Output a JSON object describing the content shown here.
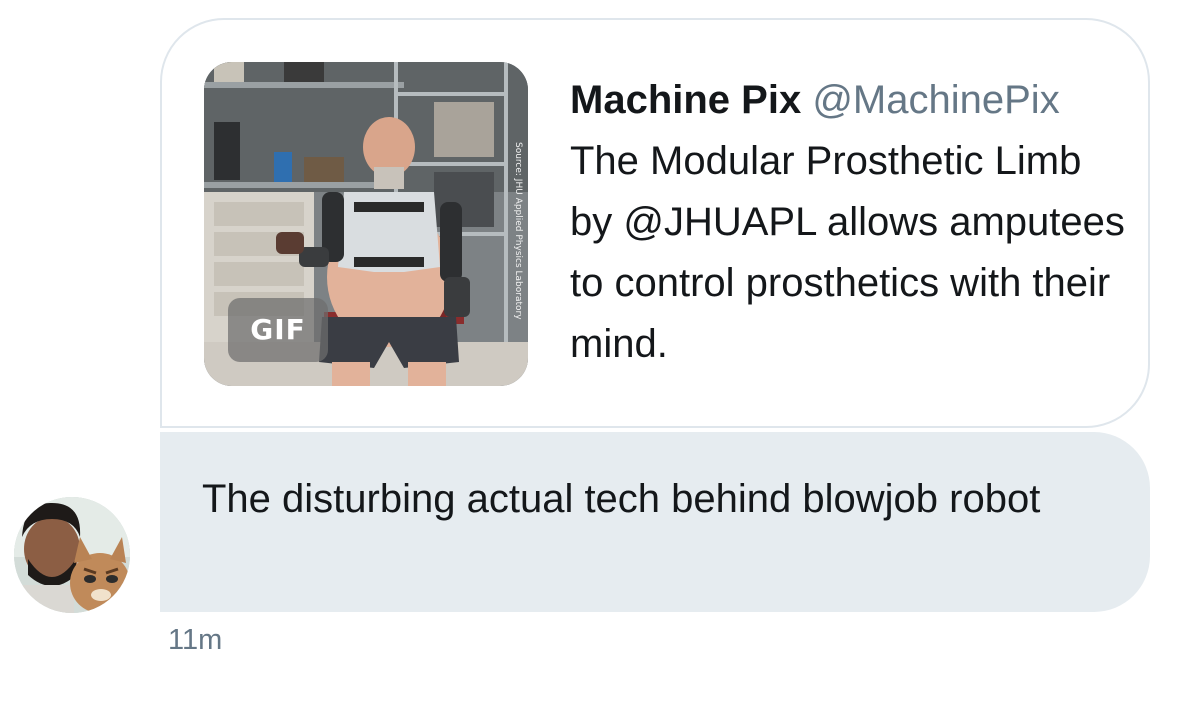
{
  "quoted_tweet": {
    "author_name": "Machine Pix",
    "author_handle": "@MachinePix",
    "text": "The Modular Prosthetic Limb by @JHUAPL allows amputees to control prosthetics with their mind.",
    "media": {
      "type": "gif",
      "badge": "GIF",
      "source_caption": "Source: JHU Applied Physics Laboratory"
    }
  },
  "message": {
    "text": "The disturbing actual tech behind blowjob robot",
    "timestamp": "11m"
  },
  "colors": {
    "bubble_bg": "#e6ecf0",
    "card_border": "#dfe6ec",
    "text_primary": "#14171a",
    "text_secondary": "#657786"
  }
}
